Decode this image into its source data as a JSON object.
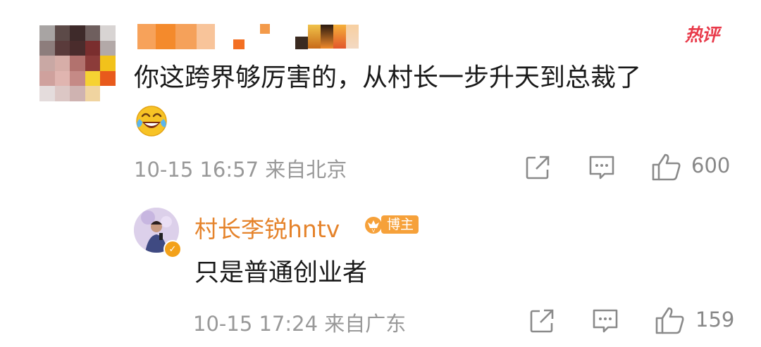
{
  "comment": {
    "hot_badge": "热评",
    "text_line1": "你这跨界够厉害的，从村长一步升天到总裁了",
    "emoji_icon": "laughing-tears-icon",
    "meta": "10-15 16:57 来自北京",
    "likes": "600"
  },
  "reply": {
    "author": "村长李锐hntv",
    "badge_label": "博主",
    "text": "只是普通创业者",
    "meta": "10-15 17:24 来自广东",
    "likes": "159"
  },
  "colors": {
    "accent_orange": "#e5832b",
    "hot_red": "#e83a4a",
    "meta_gray": "#999999"
  }
}
